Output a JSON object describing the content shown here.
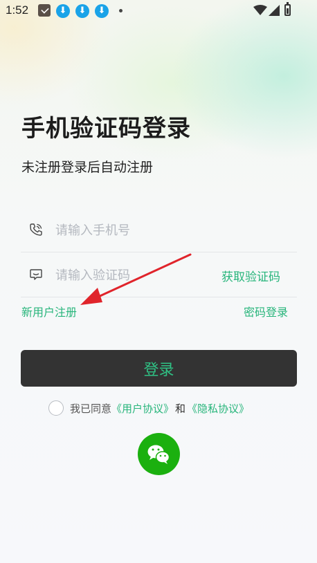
{
  "status_bar": {
    "time": "1:52",
    "icons": [
      "app-icon",
      "download-icon",
      "download-icon",
      "download-icon",
      "dot",
      "wifi-icon",
      "signal-icon",
      "battery-icon"
    ]
  },
  "login": {
    "title": "手机验证码登录",
    "subtitle": "未注册登录后自动注册",
    "phone_placeholder": "请输入手机号",
    "code_placeholder": "请输入验证码",
    "get_code_label": "获取验证码",
    "register_link": "新用户注册",
    "password_login_link": "密码登录",
    "login_button": "登录",
    "agreement": {
      "prefix": "我已同意",
      "user_agreement": "《用户协议》",
      "and": "和",
      "privacy_policy": "《隐私协议》"
    }
  },
  "colors": {
    "accent": "#27b57b",
    "button_bg": "#333333",
    "wechat": "#1bb00f",
    "arrow": "#e0242b"
  }
}
